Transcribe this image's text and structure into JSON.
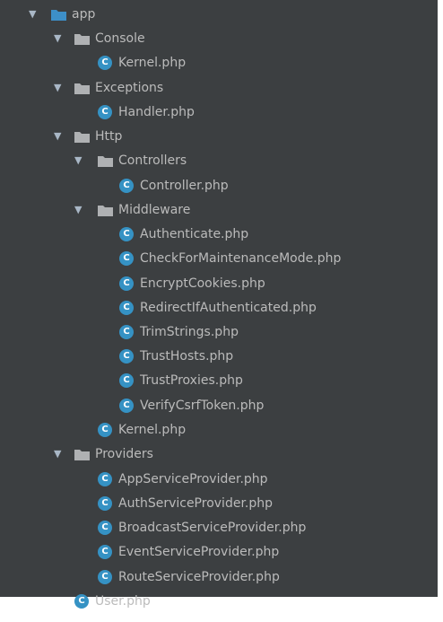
{
  "tree": {
    "app": "app",
    "console": "Console",
    "console_kernel": "Kernel.php",
    "exceptions": "Exceptions",
    "handler": "Handler.php",
    "http": "Http",
    "controllers": "Controllers",
    "controller": "Controller.php",
    "middleware": "Middleware",
    "middleware_files": [
      "Authenticate.php",
      "CheckForMaintenanceMode.php",
      "EncryptCookies.php",
      "RedirectIfAuthenticated.php",
      "TrimStrings.php",
      "TrustHosts.php",
      "TrustProxies.php",
      "VerifyCsrfToken.php"
    ],
    "http_kernel": "Kernel.php",
    "providers": "Providers",
    "provider_files": [
      "AppServiceProvider.php",
      "AuthServiceProvider.php",
      "BroadcastServiceProvider.php",
      "EventServiceProvider.php",
      "RouteServiceProvider.php"
    ],
    "user": "User.php"
  },
  "icons": {
    "expanded_arrow": "expanded-arrow-icon",
    "folder": "folder-icon",
    "class": "php-class-icon",
    "class_letter": "C"
  },
  "colors": {
    "background": "#3c3f41",
    "text": "#bbbbbb",
    "folder": "#afb1b3",
    "app_folder": "#3d8fc8",
    "class_icon": "#3592c4"
  }
}
